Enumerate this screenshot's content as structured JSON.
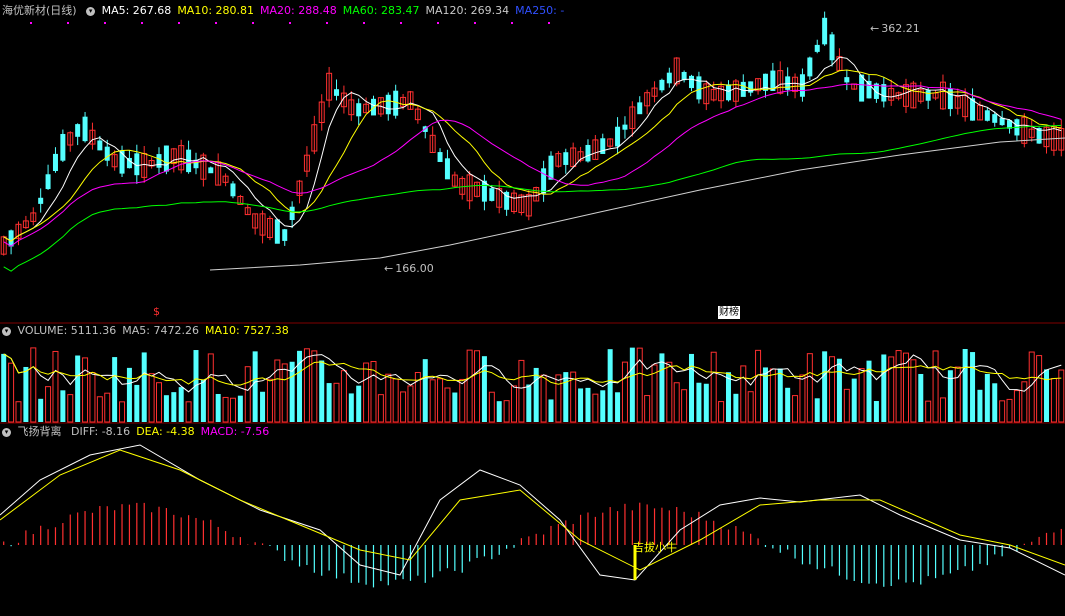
{
  "header_main": {
    "title": "海优新材(日线)",
    "items": [
      {
        "label": "MA5: 267.68",
        "color": "#ffffff"
      },
      {
        "label": "MA10: 280.81",
        "color": "#ffff00"
      },
      {
        "label": "MA20: 288.48",
        "color": "#ff00ff"
      },
      {
        "label": "MA60: 283.47",
        "color": "#00ff00"
      },
      {
        "label": "MA120: 269.34",
        "color": "#c8c8c8"
      },
      {
        "label": "MA250: -",
        "color": "#3050ff"
      }
    ]
  },
  "header_volume": {
    "items": [
      {
        "label": "VOLUME: 5111.36",
        "color": "#c0c0c0"
      },
      {
        "label": "MA5: 7472.26",
        "color": "#c0c0c0"
      },
      {
        "label": "MA10: 7527.38",
        "color": "#ffff00"
      }
    ]
  },
  "header_indicator": {
    "title": "飞扬背离",
    "items": [
      {
        "label": "DIFF: -8.16",
        "color": "#c0c0c0"
      },
      {
        "label": "DEA: -4.38",
        "color": "#ffff00"
      },
      {
        "label": "MACD: -7.56",
        "color": "#ff00ff"
      }
    ]
  },
  "annotations": {
    "high_price": "362.21",
    "low_price": "166.00",
    "dollar_mark": "$",
    "event_badge": "财榜",
    "signal_text": "吉拔小牛"
  },
  "colors": {
    "up": "#ff3030",
    "down": "#54ffff",
    "grid": "#800000"
  }
}
